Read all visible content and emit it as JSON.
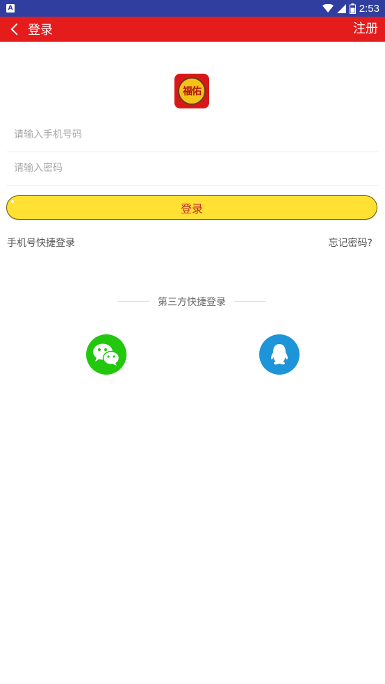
{
  "status_bar": {
    "app_icon_letter": "A",
    "time": "2:53",
    "icons": [
      "wifi-icon",
      "signal-icon",
      "battery-icon"
    ]
  },
  "app_bar": {
    "title": "登录",
    "register_label": "注册",
    "background": "#e51c1c"
  },
  "logo": {
    "text": "福佑"
  },
  "form": {
    "phone_placeholder": "请输入手机号码",
    "password_placeholder": "请输入密码",
    "login_label": "登录",
    "login_button_color": "#ffe033"
  },
  "links": {
    "quick_login": "手机号快捷登录",
    "forgot_password": "忘记密码?"
  },
  "third_party": {
    "title": "第三方快捷登录",
    "providers": [
      {
        "icon": "wechat-icon",
        "color": "#22c80e"
      },
      {
        "icon": "qq-icon",
        "color": "#1e95d8"
      }
    ]
  }
}
